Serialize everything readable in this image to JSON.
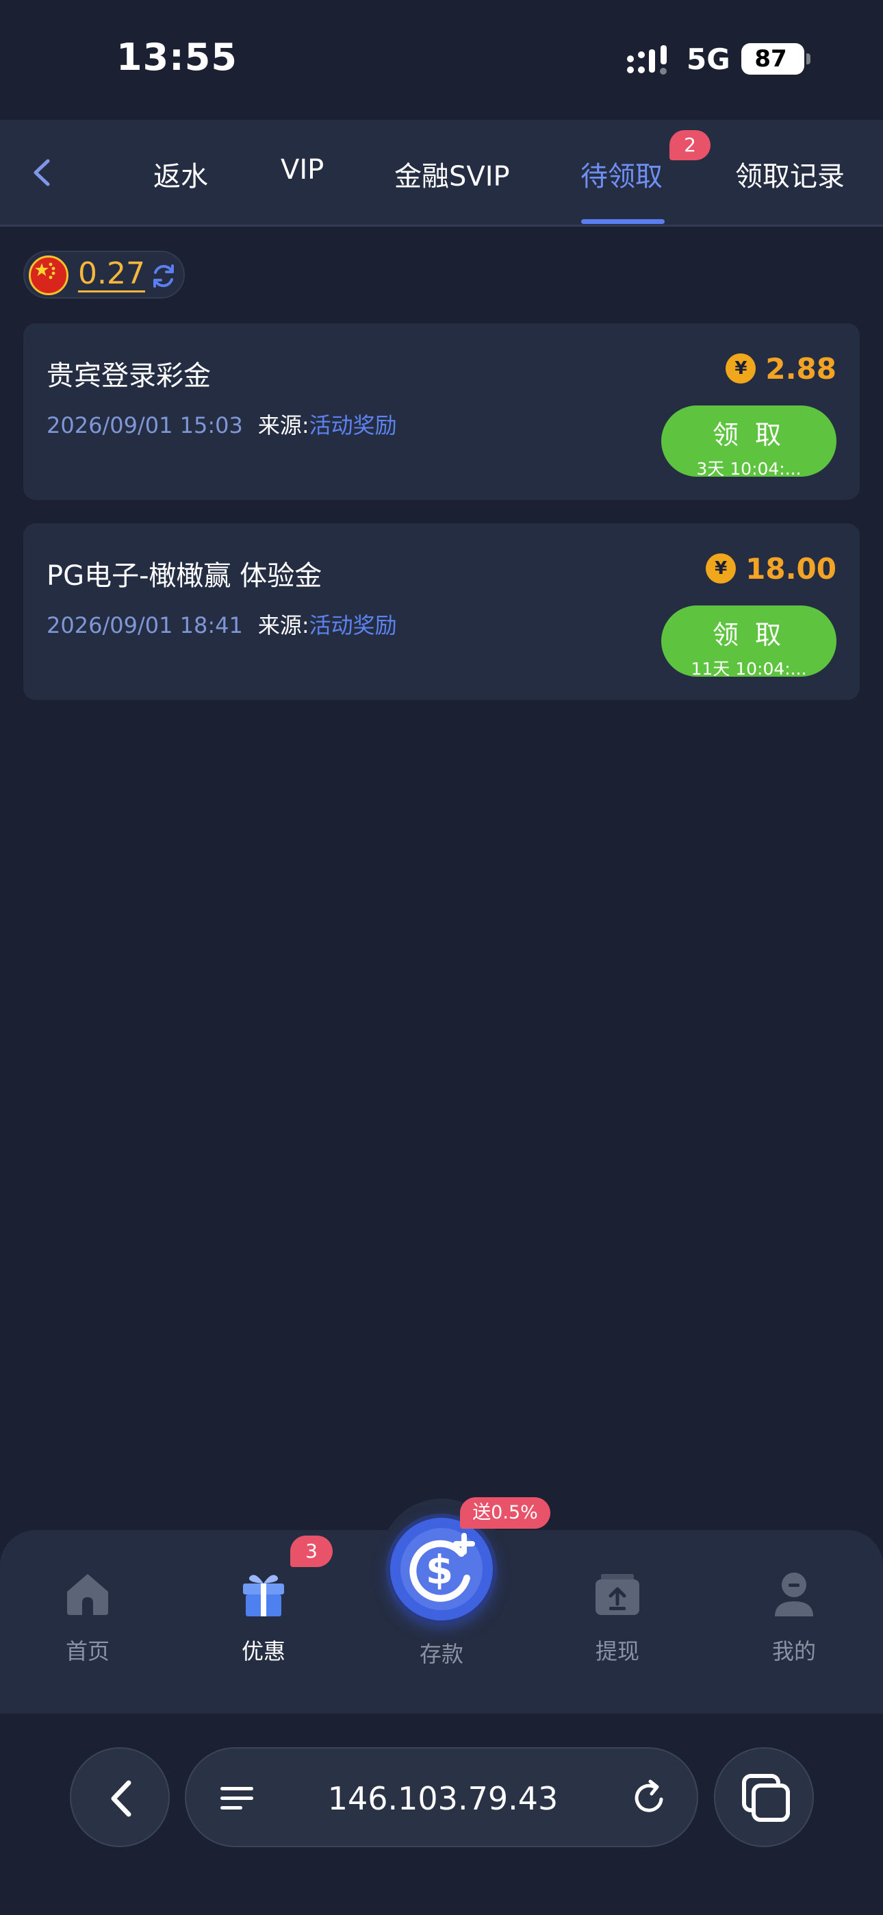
{
  "status_bar": {
    "time": "13:55",
    "network": "5G",
    "battery": "87"
  },
  "header": {
    "tabs": [
      {
        "label": "返水"
      },
      {
        "label": "VIP"
      },
      {
        "label": "金融SVIP"
      },
      {
        "label": "待领取",
        "active": true,
        "badge": "2"
      },
      {
        "label": "领取记录"
      }
    ]
  },
  "balance": {
    "value": "0.27"
  },
  "rewards": [
    {
      "title": "贵宾登录彩金",
      "date": "2026/09/01 15:03",
      "source_label": "来源:",
      "source_value": "活动奖励",
      "currency_symbol": "¥",
      "amount": "2.88",
      "button_label": "领 取",
      "timer": "3天 10:04:..."
    },
    {
      "title": "PG电子-橄橄赢 体验金",
      "date": "2026/09/01 18:41",
      "source_label": "来源:",
      "source_value": "活动奖励",
      "currency_symbol": "¥",
      "amount": "18.00",
      "button_label": "领 取",
      "timer": "11天 10:04:..."
    }
  ],
  "bottom_nav": {
    "items": [
      {
        "label": "首页",
        "icon": "home-icon"
      },
      {
        "label": "优惠",
        "icon": "gift-icon",
        "active": true,
        "badge": "3"
      },
      {
        "label": "存款",
        "icon": "deposit-dollar-icon",
        "promo": "送0.5%"
      },
      {
        "label": "提现",
        "icon": "withdraw-icon"
      },
      {
        "label": "我的",
        "icon": "profile-icon"
      }
    ]
  },
  "browser": {
    "url": "146.103.79.43"
  },
  "colors": {
    "background": "#1b2132",
    "card": "#252d42",
    "accent_blue": "#5b7ff0",
    "amount_gold": "#f4a425",
    "claim_green": "#5ec33f",
    "badge_red": "#e9536a"
  }
}
